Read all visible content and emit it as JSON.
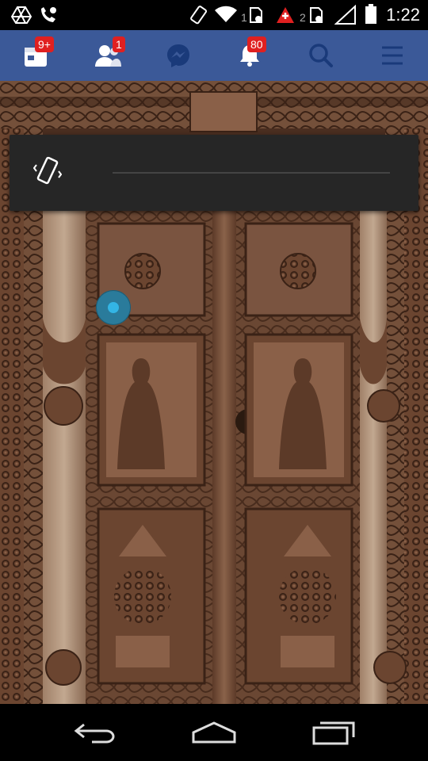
{
  "status_bar": {
    "time": "1:22",
    "sim1_label": "1",
    "sim2_label": "2",
    "icons": [
      "drive-icon",
      "phone-icon",
      "vibrate-icon",
      "wifi-icon",
      "sim1-icon",
      "alert-icon",
      "sim2-icon",
      "signal-icon",
      "battery-icon"
    ]
  },
  "fb_nav": {
    "background": "#3b5998",
    "items": [
      {
        "name": "news-feed",
        "icon": "feed-icon",
        "badge": "9+"
      },
      {
        "name": "friend-requests",
        "icon": "friends-icon",
        "badge": "1"
      },
      {
        "name": "messenger",
        "icon": "messenger-icon",
        "badge": ""
      },
      {
        "name": "notifications",
        "icon": "bell-icon",
        "badge": "80"
      },
      {
        "name": "search",
        "icon": "search-icon",
        "badge": ""
      },
      {
        "name": "menu",
        "icon": "menu-icon",
        "badge": ""
      }
    ]
  },
  "volume_overlay": {
    "mode_icon": "vibrate-icon",
    "level": 0,
    "accent": "#33b5e5"
  },
  "content": {
    "image": "carved wooden door"
  },
  "system_nav": [
    "back-icon",
    "home-icon",
    "recents-icon"
  ]
}
